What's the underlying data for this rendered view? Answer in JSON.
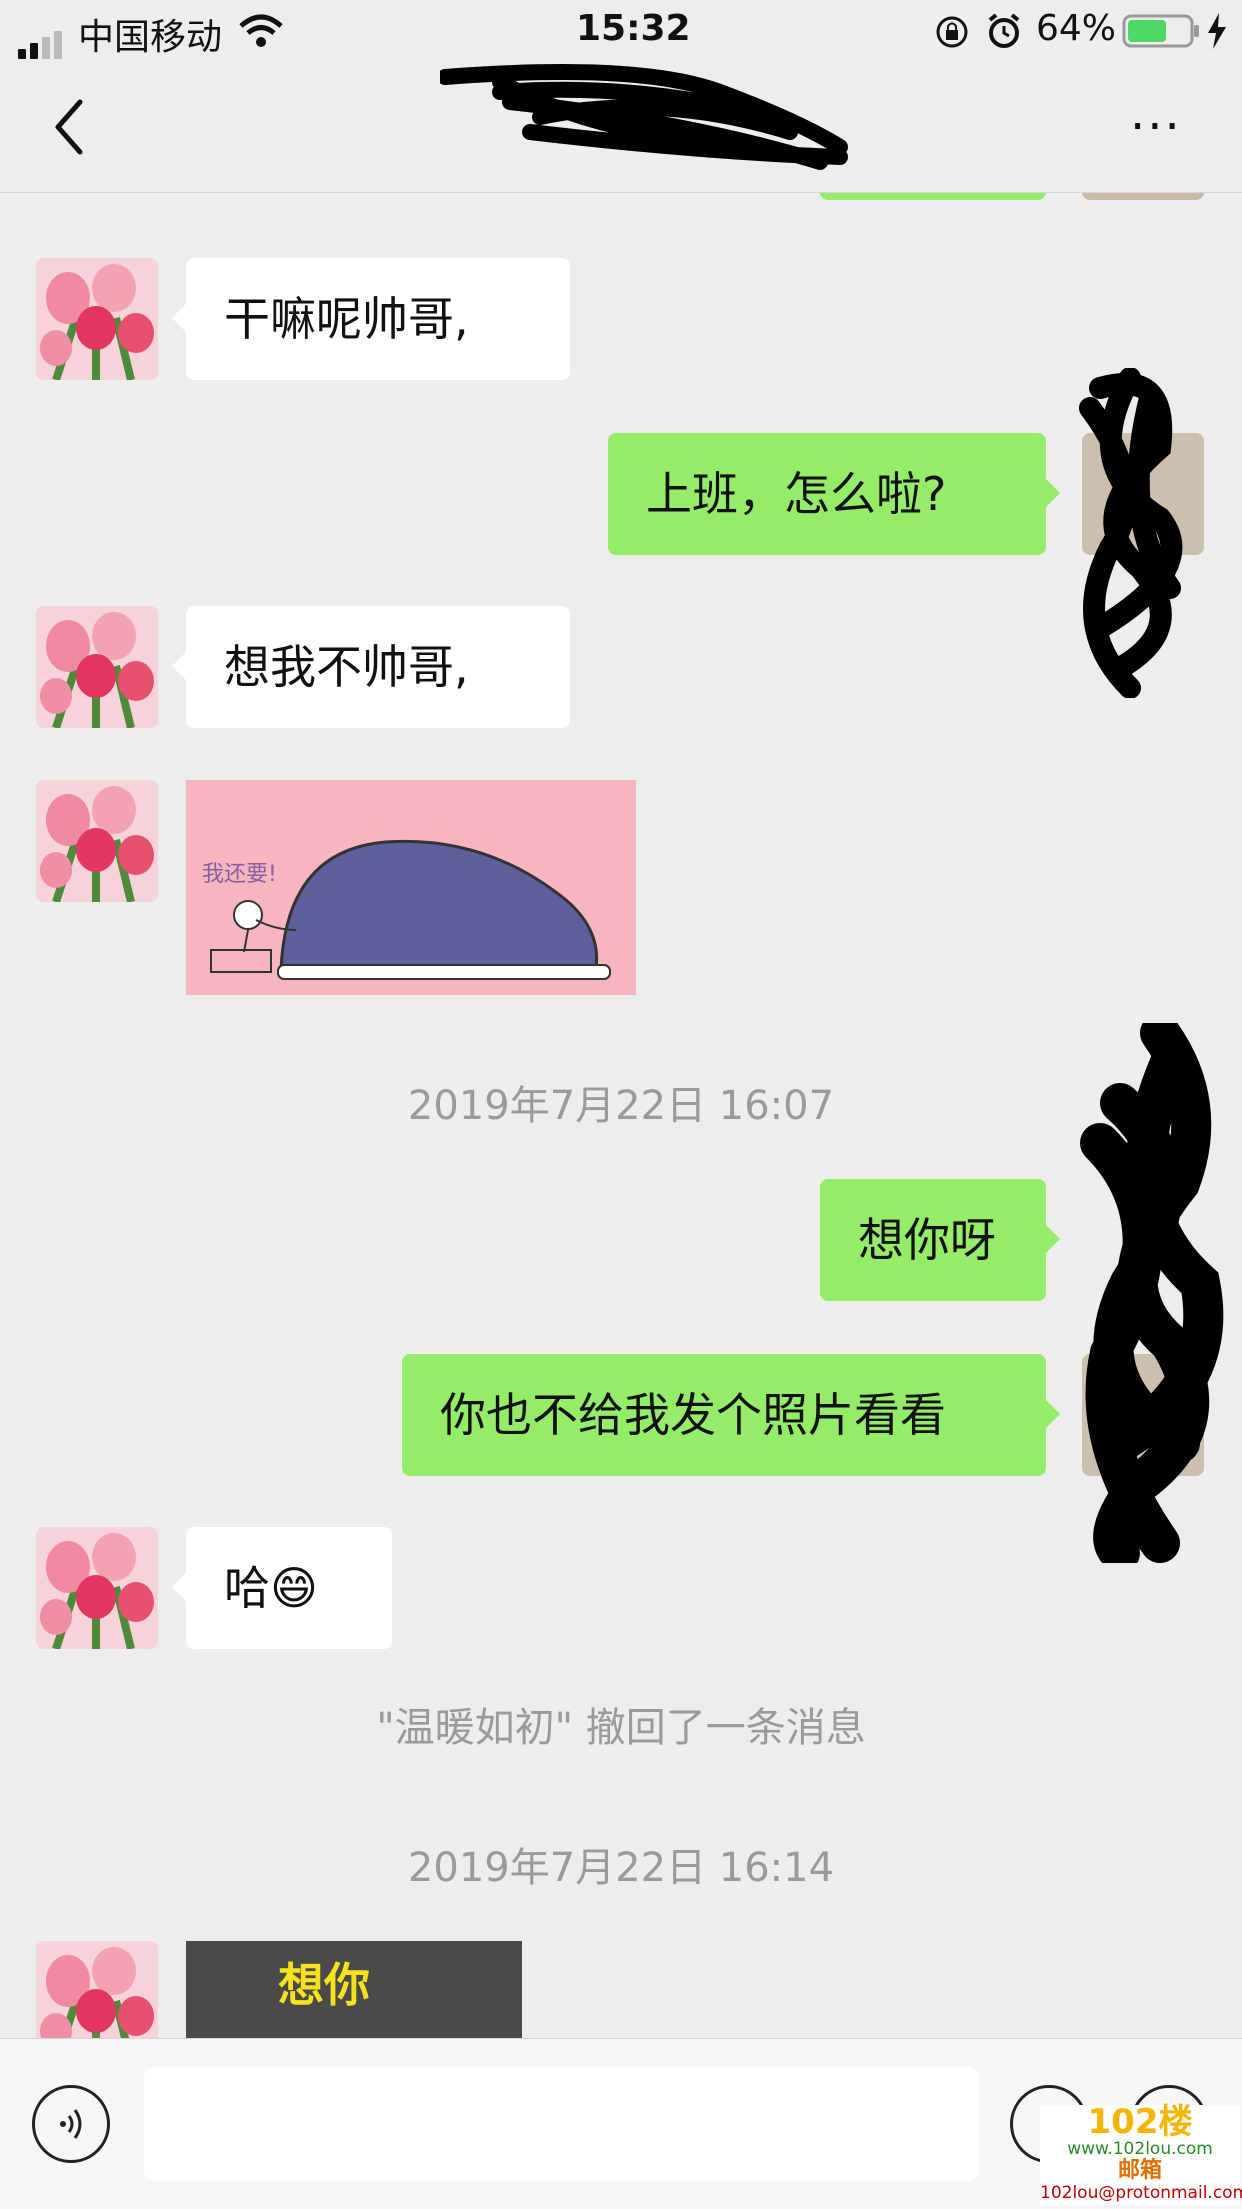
{
  "status_bar": {
    "carrier": "中国移动",
    "time": "15:32",
    "battery_percent": "64%",
    "battery_level": 0.64,
    "icons": [
      "signal-icon",
      "wifi-icon",
      "rotation-lock-icon",
      "alarm-icon",
      "battery-icon",
      "charging-icon"
    ]
  },
  "nav": {
    "back_icon": "chevron-left-icon",
    "more_icon": "ellipsis-icon",
    "more_label": "···"
  },
  "messages": [
    {
      "side": "in",
      "text": "干嘛呢帅哥,"
    },
    {
      "side": "out",
      "text": "上班，怎么啦?"
    },
    {
      "side": "in",
      "text": "想我不帅哥,"
    },
    {
      "side": "in",
      "type": "sticker",
      "caption": "我还要!"
    },
    {
      "type": "time",
      "text": "2019年7月22日 16:07"
    },
    {
      "side": "out",
      "text": "想你呀"
    },
    {
      "side": "out",
      "text": "你也不给我发个照片看看"
    },
    {
      "side": "in",
      "text": "哈😄"
    },
    {
      "type": "system",
      "text": "\"温暖如初\" 撤回了一条消息"
    },
    {
      "type": "time",
      "text": "2019年7月22日 16:14"
    },
    {
      "side": "in",
      "type": "image",
      "caption": "想你"
    }
  ],
  "input_bar": {
    "voice_icon": "voice-icon",
    "emoji_icon": "emoji-icon",
    "plus_icon": "plus-icon"
  },
  "watermark": {
    "logo": "102楼",
    "site": "www.102lou.com",
    "label": "邮箱",
    "email": "102lou@protonmail.com"
  },
  "colors": {
    "background": "#ededed",
    "outgoing_bubble": "#95ec69",
    "incoming_bubble": "#ffffff",
    "system_text": "#9a9a9a"
  }
}
